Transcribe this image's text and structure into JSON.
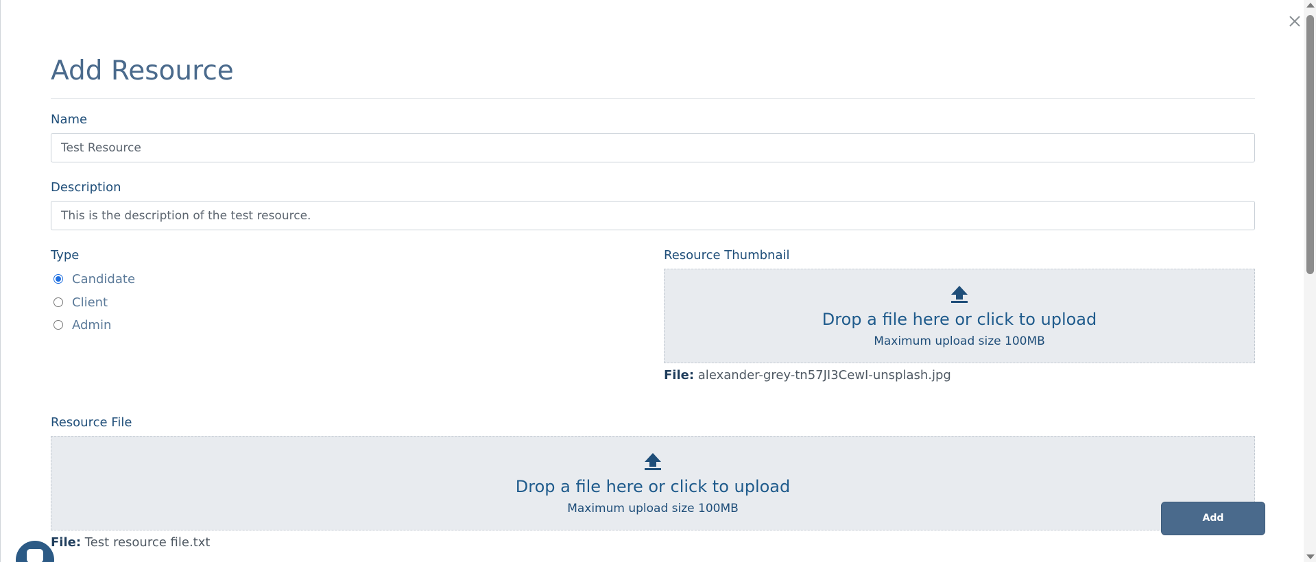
{
  "modal": {
    "title": "Add Resource",
    "close_icon": "close-icon"
  },
  "form": {
    "name": {
      "label": "Name",
      "value": "Test Resource"
    },
    "description": {
      "label": "Description",
      "value": "This is the description of the test resource."
    },
    "type": {
      "label": "Type",
      "options": [
        {
          "label": "Candidate",
          "checked": true
        },
        {
          "label": "Client",
          "checked": false
        },
        {
          "label": "Admin",
          "checked": false
        }
      ]
    },
    "thumbnail": {
      "label": "Resource Thumbnail",
      "dropzone_text": "Drop a file here or click to upload",
      "dropzone_hint": "Maximum upload size 100MB",
      "file_key": "File:",
      "file_name": "alexander-grey-tn57JI3CewI-unsplash.jpg",
      "icon": "upload-icon"
    },
    "resource_file": {
      "label": "Resource File",
      "dropzone_text": "Drop a file here or click to upload",
      "dropzone_hint": "Maximum upload size 100MB",
      "file_key": "File:",
      "file_name": "Test resource file.txt",
      "icon": "upload-icon"
    }
  },
  "actions": {
    "add_label": "Add"
  },
  "colors": {
    "accent": "#4a6a8c",
    "label": "#1f4e79",
    "dropzone_bg": "#e8ebef",
    "radio_checked": "#1f6fe0"
  }
}
